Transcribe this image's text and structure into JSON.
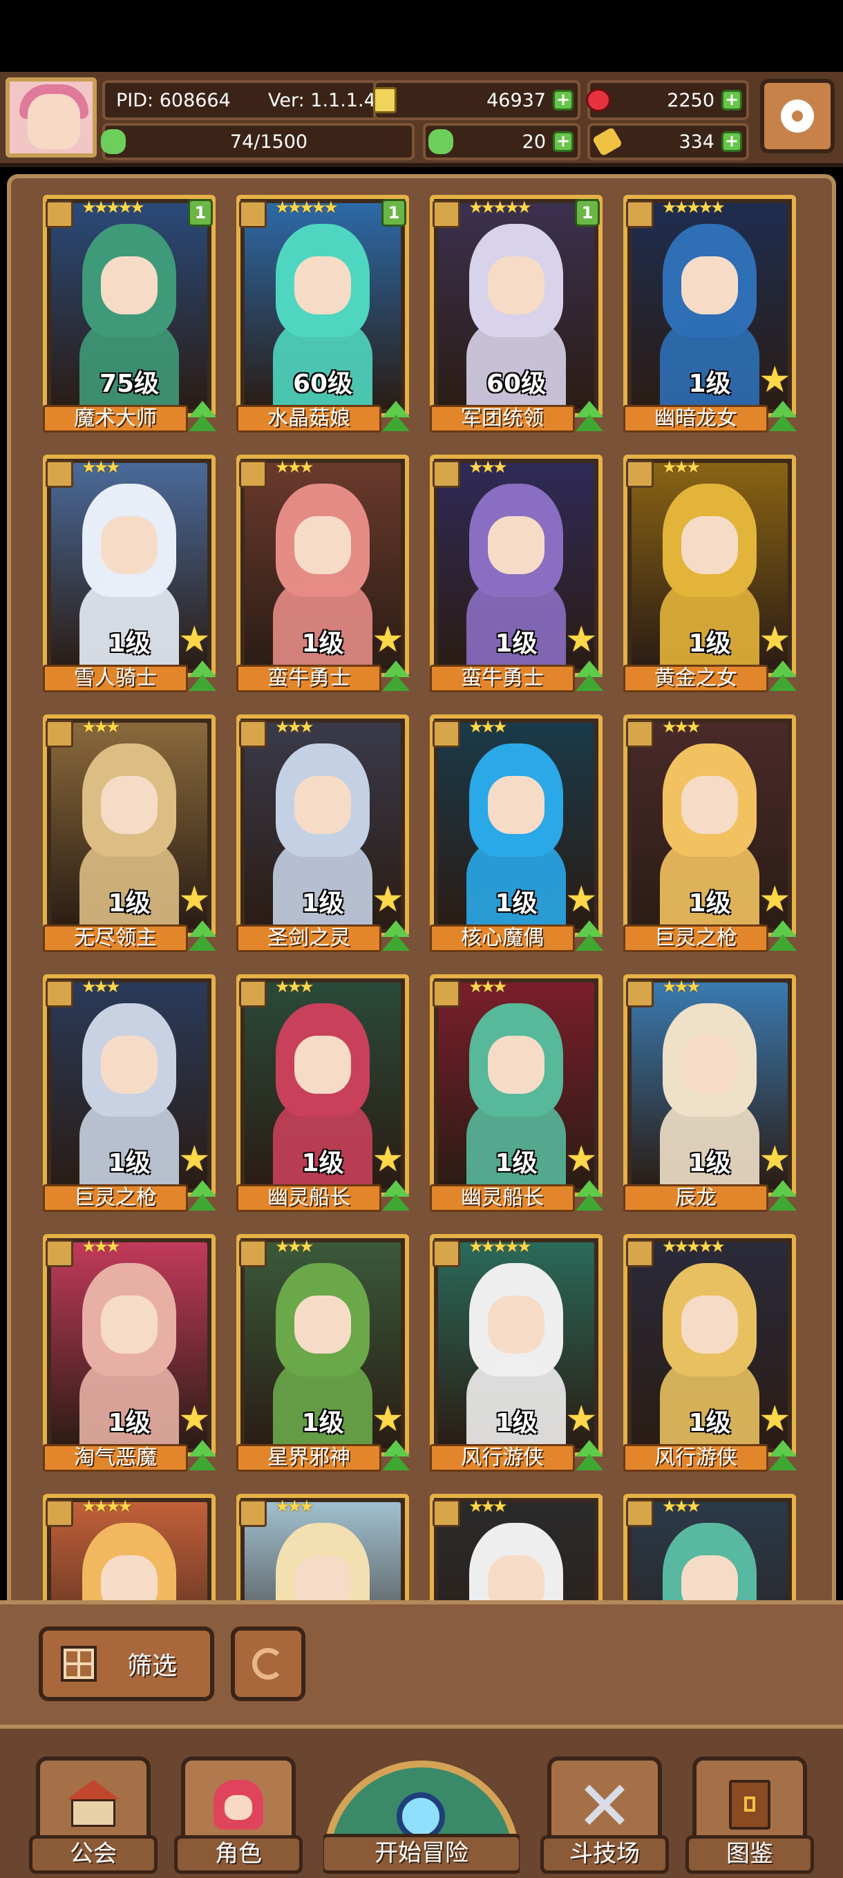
{
  "hud": {
    "pid": "PID: 608664",
    "version": "Ver: 1.1.1.4",
    "gold": "46937",
    "gems": "2250",
    "exp": "74/1500",
    "clover": "20",
    "keys": "334"
  },
  "heroes": [
    {
      "name": "魔术大师",
      "level": "75级",
      "stars": "★★★★★",
      "badge": "1",
      "colors": [
        "#3e9a78",
        "#2a4a7a"
      ]
    },
    {
      "name": "水晶菇娘",
      "level": "60级",
      "stars": "★★★★★",
      "badge": "1",
      "colors": [
        "#4fd6c0",
        "#2c6aa8"
      ]
    },
    {
      "name": "军团统领",
      "level": "60级",
      "stars": "★★★★★",
      "badge": "1",
      "colors": [
        "#d8d2ea",
        "#3b3150"
      ]
    },
    {
      "name": "幽暗龙女",
      "level": "1级",
      "stars": "★★★★★",
      "badge": "",
      "colors": [
        "#2e6fb6",
        "#1e2d50"
      ]
    },
    {
      "name": "雪人骑士",
      "level": "1级",
      "stars": "★★★",
      "badge": "",
      "colors": [
        "#e8eef8",
        "#4a6a9a"
      ]
    },
    {
      "name": "蛮牛勇士",
      "level": "1级",
      "stars": "★★★",
      "badge": "",
      "colors": [
        "#e58b86",
        "#6a3a2c"
      ]
    },
    {
      "name": "蛮牛勇士",
      "level": "1级",
      "stars": "★★★",
      "badge": "",
      "colors": [
        "#8a6ec2",
        "#2f2a58"
      ]
    },
    {
      "name": "黄金之女",
      "level": "1级",
      "stars": "★★★",
      "badge": "",
      "colors": [
        "#e2b43a",
        "#8a6414"
      ]
    },
    {
      "name": "无尽领主",
      "level": "1级",
      "stars": "★★★",
      "badge": "",
      "colors": [
        "#dcbd84",
        "#8a6a3c"
      ]
    },
    {
      "name": "圣剑之灵",
      "level": "1级",
      "stars": "★★★",
      "badge": "",
      "colors": [
        "#c4d0e4",
        "#3a3a4a"
      ]
    },
    {
      "name": "核心魔偶",
      "level": "1级",
      "stars": "★★★",
      "badge": "",
      "colors": [
        "#2aa8e8",
        "#1a3a4a"
      ]
    },
    {
      "name": "巨灵之枪",
      "level": "1级",
      "stars": "★★★",
      "badge": "",
      "colors": [
        "#f2c260",
        "#4a2a2a"
      ]
    },
    {
      "name": "巨灵之枪",
      "level": "1级",
      "stars": "★★★",
      "badge": "",
      "colors": [
        "#c8d2e2",
        "#2a3a5a"
      ]
    },
    {
      "name": "幽灵船长",
      "level": "1级",
      "stars": "★★★",
      "badge": "",
      "colors": [
        "#c8405a",
        "#2a4a3a"
      ]
    },
    {
      "name": "幽灵船长",
      "level": "1级",
      "stars": "★★★",
      "badge": "",
      "colors": [
        "#58b89a",
        "#7a1e2a"
      ]
    },
    {
      "name": "辰龙",
      "level": "1级",
      "stars": "★★★",
      "badge": "",
      "colors": [
        "#efe0c8",
        "#3a7ab0"
      ]
    },
    {
      "name": "淘气恶魔",
      "level": "1级",
      "stars": "★★★",
      "badge": "",
      "colors": [
        "#e8b0a4",
        "#c23a5a"
      ]
    },
    {
      "name": "星界邪神",
      "level": "1级",
      "stars": "★★★",
      "badge": "",
      "colors": [
        "#6aa84a",
        "#3a5a3a"
      ]
    },
    {
      "name": "风行游侠",
      "level": "1级",
      "stars": "★★★★★",
      "badge": "",
      "colors": [
        "#eeeeee",
        "#2a6a5a"
      ]
    },
    {
      "name": "风行游侠",
      "level": "1级",
      "stars": "★★★★★",
      "badge": "",
      "colors": [
        "#e8c060",
        "#2a2a3a"
      ]
    },
    {
      "name": "",
      "level": "",
      "stars": "★★★★",
      "badge": "",
      "colors": [
        "#f2b860",
        "#c2603a"
      ]
    },
    {
      "name": "",
      "level": "",
      "stars": "★★★",
      "badge": "",
      "colors": [
        "#f2e0b0",
        "#a0c0d0"
      ]
    },
    {
      "name": "",
      "level": "",
      "stars": "★★★",
      "badge": "",
      "colors": [
        "#eeeeee",
        "#2a2a2a"
      ]
    },
    {
      "name": "",
      "level": "",
      "stars": "★★★",
      "badge": "",
      "colors": [
        "#58b8a0",
        "#2a3a4a"
      ]
    }
  ],
  "filter_button": "筛选",
  "nav": {
    "guild": "公会",
    "character": "角色",
    "adventure": "开始冒险",
    "arena": "斗技场",
    "codex": "图鉴"
  },
  "icons": [
    "coin-icon",
    "gem-icon",
    "clover-icon",
    "key-icon",
    "plus-icon",
    "gear-icon",
    "refresh-icon",
    "grid-icon",
    "magnifier-icon",
    "swords-icon",
    "book-icon",
    "house-icon"
  ]
}
